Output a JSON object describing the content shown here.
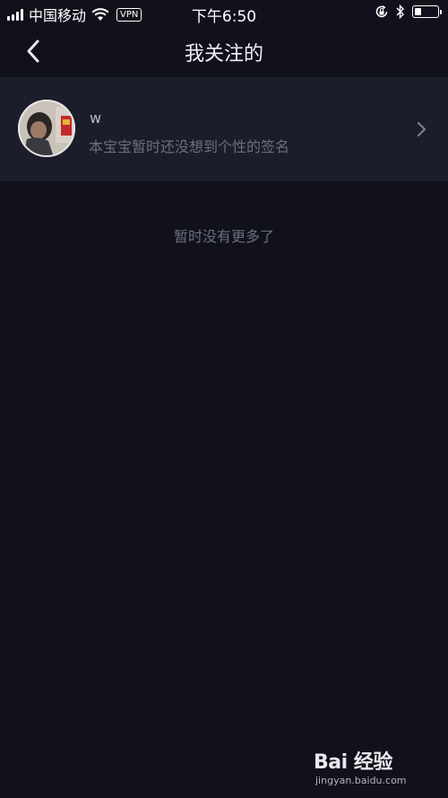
{
  "status_bar": {
    "carrier": "中国移动",
    "vpn": "VPN",
    "time": "下午6:50",
    "battery_level": 0.3
  },
  "nav": {
    "title": "我关注的"
  },
  "following": [
    {
      "name": "w",
      "signature": "本宝宝暂时还没想到个性的签名"
    }
  ],
  "footer_text": "暂时没有更多了",
  "watermark": {
    "logo": "Bai 经验",
    "url": "jingyan.baidu.com"
  },
  "icons": [
    "signal-icon",
    "wifi-icon",
    "rotation-lock-icon",
    "bluetooth-icon",
    "battery-icon",
    "back-arrow-icon",
    "chevron-right-icon"
  ]
}
